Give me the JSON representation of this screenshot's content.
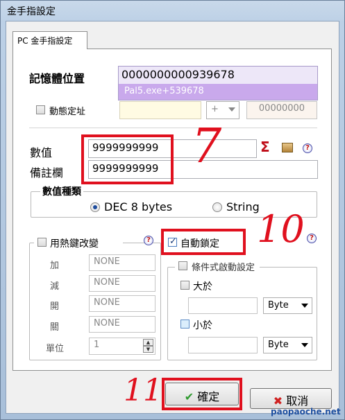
{
  "window": {
    "title": "金手指設定"
  },
  "tabs": [
    {
      "label": "PC 金手指設定"
    }
  ],
  "memory": {
    "label": "記憶體位置",
    "address": "0000000000939678",
    "module_offset": "Pal5.exe+539678"
  },
  "dynamic_address": {
    "label": "動態定址",
    "operator": "+",
    "offset": "00000000"
  },
  "value": {
    "label": "數值",
    "text": "9999999999"
  },
  "note": {
    "label": "備註欄",
    "text": "9999999999"
  },
  "value_type": {
    "legend": "數值種類",
    "options": [
      "DEC 8 bytes",
      "String"
    ],
    "selected": "DEC 8 bytes"
  },
  "hotkey_group": {
    "label": "用熱鍵改變",
    "rows": [
      {
        "label": "加",
        "value": "NONE"
      },
      {
        "label": "減",
        "value": "NONE"
      },
      {
        "label": "開",
        "value": "NONE"
      },
      {
        "label": "關",
        "value": "NONE"
      }
    ],
    "unit_label": "單位",
    "unit_value": "1"
  },
  "auto_lock": {
    "label": "自動鎖定",
    "checked": true
  },
  "condition": {
    "label": "條件式啟動設定",
    "greater_label": "大於",
    "greater_type": "Byte",
    "less_label": "小於",
    "less_type": "Byte"
  },
  "buttons": {
    "ok": "確定",
    "cancel": "取消"
  },
  "annotations": {
    "a7": "7",
    "a10": "10",
    "a11": "11"
  },
  "watermark": "paopaoche.net",
  "colors": {
    "highlight_red": "#e0101e",
    "module_bar": "#c9a9ec",
    "ok_green": "#2e9a2e",
    "cancel_red": "#d02020"
  },
  "icons": {
    "sum": "sigma-icon",
    "box": "package-icon",
    "help": "help-icon"
  }
}
